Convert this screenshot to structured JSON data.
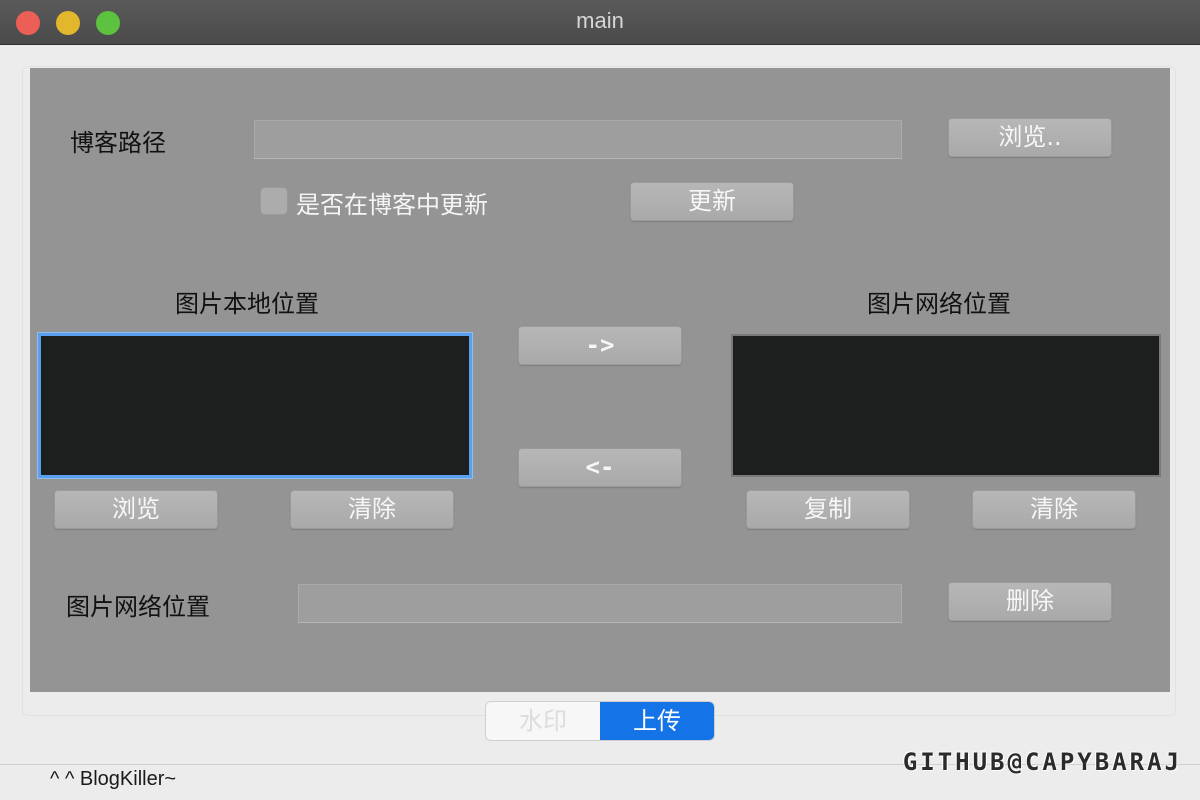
{
  "window": {
    "title": "main"
  },
  "blog": {
    "path_label": "博客路径",
    "path_value": "",
    "browse_label": "浏览..",
    "update_checkbox_label": "是否在博客中更新",
    "update_checked": false,
    "update_button_label": "更新"
  },
  "images": {
    "local_title": "图片本地位置",
    "net_title": "图片网络位置",
    "to_right_label": "->",
    "to_left_label": "<-",
    "local_browse_label": "浏览",
    "local_clear_label": "清除",
    "net_copy_label": "复制",
    "net_clear_label": "清除"
  },
  "delete_row": {
    "label": "图片网络位置",
    "value": "",
    "delete_label": "删除"
  },
  "mode_tabs": [
    {
      "label": "水印",
      "selected": false
    },
    {
      "label": "上传",
      "selected": true
    }
  ],
  "status": {
    "text": "^ ^ BlogKiller~"
  },
  "watermark": {
    "text": "GITHUB@CAPYBARAJ"
  },
  "colors": {
    "panel_bg": "#949494",
    "list_bg": "#1d1f1f",
    "focus_ring": "#5aa0ee",
    "selected_tab": "#1473e6"
  }
}
